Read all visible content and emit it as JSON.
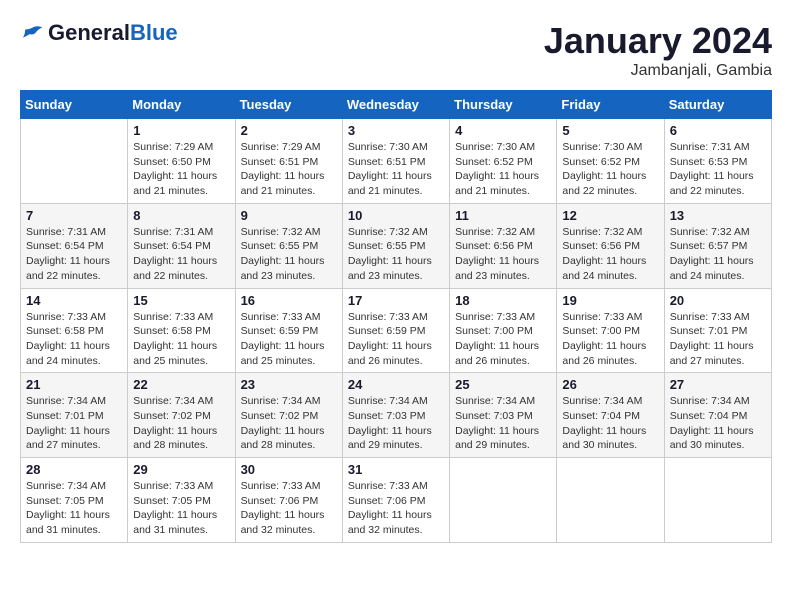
{
  "header": {
    "logo_general": "General",
    "logo_blue": "Blue",
    "month_year": "January 2024",
    "location": "Jambanjali, Gambia"
  },
  "days": [
    "Sunday",
    "Monday",
    "Tuesday",
    "Wednesday",
    "Thursday",
    "Friday",
    "Saturday"
  ],
  "weeks": [
    [
      {
        "date": "",
        "info": ""
      },
      {
        "date": "1",
        "info": "Sunrise: 7:29 AM\nSunset: 6:50 PM\nDaylight: 11 hours\nand 21 minutes."
      },
      {
        "date": "2",
        "info": "Sunrise: 7:29 AM\nSunset: 6:51 PM\nDaylight: 11 hours\nand 21 minutes."
      },
      {
        "date": "3",
        "info": "Sunrise: 7:30 AM\nSunset: 6:51 PM\nDaylight: 11 hours\nand 21 minutes."
      },
      {
        "date": "4",
        "info": "Sunrise: 7:30 AM\nSunset: 6:52 PM\nDaylight: 11 hours\nand 21 minutes."
      },
      {
        "date": "5",
        "info": "Sunrise: 7:30 AM\nSunset: 6:52 PM\nDaylight: 11 hours\nand 22 minutes."
      },
      {
        "date": "6",
        "info": "Sunrise: 7:31 AM\nSunset: 6:53 PM\nDaylight: 11 hours\nand 22 minutes."
      }
    ],
    [
      {
        "date": "7",
        "info": "Sunrise: 7:31 AM\nSunset: 6:54 PM\nDaylight: 11 hours\nand 22 minutes."
      },
      {
        "date": "8",
        "info": "Sunrise: 7:31 AM\nSunset: 6:54 PM\nDaylight: 11 hours\nand 22 minutes."
      },
      {
        "date": "9",
        "info": "Sunrise: 7:32 AM\nSunset: 6:55 PM\nDaylight: 11 hours\nand 23 minutes."
      },
      {
        "date": "10",
        "info": "Sunrise: 7:32 AM\nSunset: 6:55 PM\nDaylight: 11 hours\nand 23 minutes."
      },
      {
        "date": "11",
        "info": "Sunrise: 7:32 AM\nSunset: 6:56 PM\nDaylight: 11 hours\nand 23 minutes."
      },
      {
        "date": "12",
        "info": "Sunrise: 7:32 AM\nSunset: 6:56 PM\nDaylight: 11 hours\nand 24 minutes."
      },
      {
        "date": "13",
        "info": "Sunrise: 7:32 AM\nSunset: 6:57 PM\nDaylight: 11 hours\nand 24 minutes."
      }
    ],
    [
      {
        "date": "14",
        "info": "Sunrise: 7:33 AM\nSunset: 6:58 PM\nDaylight: 11 hours\nand 24 minutes."
      },
      {
        "date": "15",
        "info": "Sunrise: 7:33 AM\nSunset: 6:58 PM\nDaylight: 11 hours\nand 25 minutes."
      },
      {
        "date": "16",
        "info": "Sunrise: 7:33 AM\nSunset: 6:59 PM\nDaylight: 11 hours\nand 25 minutes."
      },
      {
        "date": "17",
        "info": "Sunrise: 7:33 AM\nSunset: 6:59 PM\nDaylight: 11 hours\nand 26 minutes."
      },
      {
        "date": "18",
        "info": "Sunrise: 7:33 AM\nSunset: 7:00 PM\nDaylight: 11 hours\nand 26 minutes."
      },
      {
        "date": "19",
        "info": "Sunrise: 7:33 AM\nSunset: 7:00 PM\nDaylight: 11 hours\nand 26 minutes."
      },
      {
        "date": "20",
        "info": "Sunrise: 7:33 AM\nSunset: 7:01 PM\nDaylight: 11 hours\nand 27 minutes."
      }
    ],
    [
      {
        "date": "21",
        "info": "Sunrise: 7:34 AM\nSunset: 7:01 PM\nDaylight: 11 hours\nand 27 minutes."
      },
      {
        "date": "22",
        "info": "Sunrise: 7:34 AM\nSunset: 7:02 PM\nDaylight: 11 hours\nand 28 minutes."
      },
      {
        "date": "23",
        "info": "Sunrise: 7:34 AM\nSunset: 7:02 PM\nDaylight: 11 hours\nand 28 minutes."
      },
      {
        "date": "24",
        "info": "Sunrise: 7:34 AM\nSunset: 7:03 PM\nDaylight: 11 hours\nand 29 minutes."
      },
      {
        "date": "25",
        "info": "Sunrise: 7:34 AM\nSunset: 7:03 PM\nDaylight: 11 hours\nand 29 minutes."
      },
      {
        "date": "26",
        "info": "Sunrise: 7:34 AM\nSunset: 7:04 PM\nDaylight: 11 hours\nand 30 minutes."
      },
      {
        "date": "27",
        "info": "Sunrise: 7:34 AM\nSunset: 7:04 PM\nDaylight: 11 hours\nand 30 minutes."
      }
    ],
    [
      {
        "date": "28",
        "info": "Sunrise: 7:34 AM\nSunset: 7:05 PM\nDaylight: 11 hours\nand 31 minutes."
      },
      {
        "date": "29",
        "info": "Sunrise: 7:33 AM\nSunset: 7:05 PM\nDaylight: 11 hours\nand 31 minutes."
      },
      {
        "date": "30",
        "info": "Sunrise: 7:33 AM\nSunset: 7:06 PM\nDaylight: 11 hours\nand 32 minutes."
      },
      {
        "date": "31",
        "info": "Sunrise: 7:33 AM\nSunset: 7:06 PM\nDaylight: 11 hours\nand 32 minutes."
      },
      {
        "date": "",
        "info": ""
      },
      {
        "date": "",
        "info": ""
      },
      {
        "date": "",
        "info": ""
      }
    ]
  ]
}
